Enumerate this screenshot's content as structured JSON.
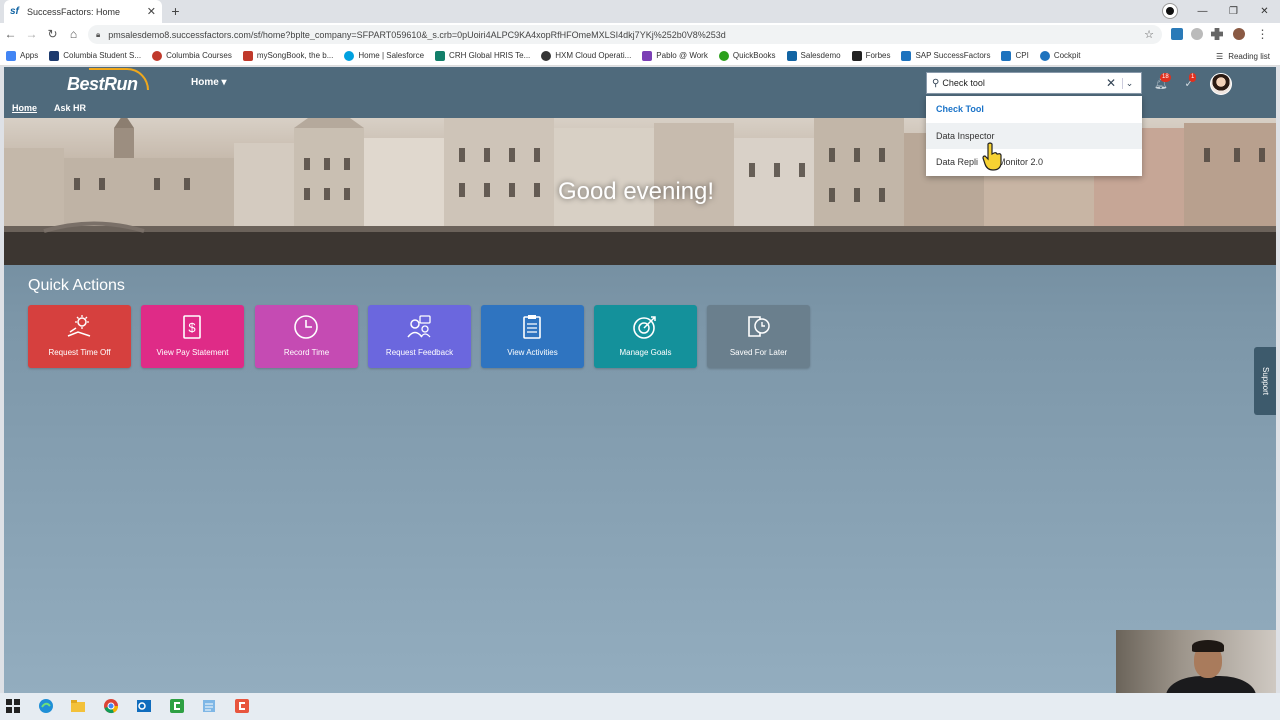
{
  "browser": {
    "tab_title": "SuccessFactors: Home",
    "tab_favicon": "sf",
    "url": "pmsalesdemo8.successfactors.com/sf/home?bplte_company=SFPART059610&_s.crb=0pUoiri4ALPC9KA4xopRfHFOmeMXLSI4dkj7YKj%252b0V8%253d",
    "bookmarks": [
      {
        "label": "Apps",
        "color": "#4285f4"
      },
      {
        "label": "Columbia Student S...",
        "color": "#1d3a6e"
      },
      {
        "label": "Columbia Courses",
        "color": "#c0392b"
      },
      {
        "label": "mySongBook, the b...",
        "color": "#c0392b"
      },
      {
        "label": "Home | Salesforce",
        "color": "#00a1e0"
      },
      {
        "label": "CRH Global HRIS Te...",
        "color": "#137f6a"
      },
      {
        "label": "HXM Cloud Operati...",
        "color": "#333333"
      },
      {
        "label": "Pablo @ Work",
        "color": "#7b3fb5"
      },
      {
        "label": "QuickBooks",
        "color": "#2ca01c"
      },
      {
        "label": "Salesdemo",
        "color": "#1264a3"
      },
      {
        "label": "Forbes",
        "color": "#222222"
      },
      {
        "label": "SAP SuccessFactors",
        "color": "#1e73be"
      },
      {
        "label": "CPI",
        "color": "#1e73be"
      },
      {
        "label": "Cockpit",
        "color": "#1e73be"
      }
    ],
    "reading_list": "Reading list"
  },
  "header": {
    "logo": "BestRun",
    "home_menu": "Home ▾",
    "subnav": [
      {
        "label": "Home",
        "active": true
      },
      {
        "label": "Ask HR",
        "active": false
      }
    ],
    "search_value": "Check tool",
    "notifications_count": "18",
    "approvals_count": "1"
  },
  "search_dropdown": {
    "header": "Check Tool",
    "items": [
      "Data Inspector",
      "Data Repli        Monitor 2.0"
    ]
  },
  "hero": {
    "greeting": "Good evening!"
  },
  "quick_actions": {
    "title": "Quick Actions",
    "tiles": [
      {
        "label": "Request Time Off",
        "icon": "sun-person-icon",
        "color": "#d6403e"
      },
      {
        "label": "View Pay Statement",
        "icon": "dollar-document-icon",
        "color": "#df2b87"
      },
      {
        "label": "Record Time",
        "icon": "clock-icon",
        "color": "#c54bb3"
      },
      {
        "label": "Request Feedback",
        "icon": "people-feedback-icon",
        "color": "#6b67de"
      },
      {
        "label": "View Activities",
        "icon": "clipboard-icon",
        "color": "#2f74c0"
      },
      {
        "label": "Manage Goals",
        "icon": "target-icon",
        "color": "#14919b"
      },
      {
        "label": "Saved For Later",
        "icon": "saved-clock-icon",
        "color": "#6a7f8d"
      }
    ]
  },
  "support_tab": "Support"
}
